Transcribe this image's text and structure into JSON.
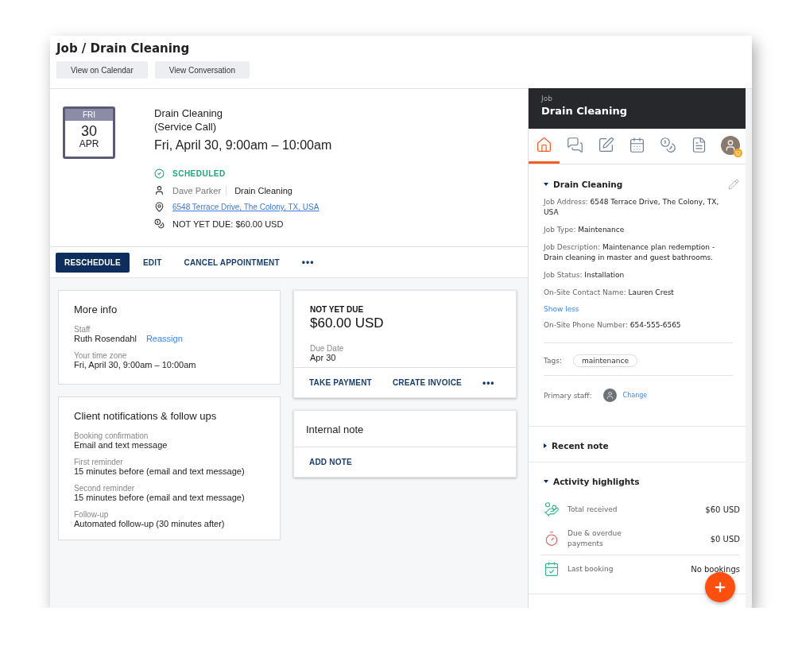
{
  "header": {
    "title": "Job / Drain Cleaning",
    "buttons": [
      "View on Calendar",
      "View Conversation"
    ]
  },
  "summary": {
    "calendar": {
      "weekday": "FRI",
      "day": "30",
      "month": "APR"
    },
    "title_lines": [
      "Drain Cleaning",
      "(Service Call)"
    ],
    "datetime": "Fri, April 30, 9:00am – 10:00am",
    "status": "SCHEDULED",
    "staff": "Dave Parker",
    "service": "Drain Cleaning",
    "address": "6548 Terrace Drive, The Colony, TX, USA",
    "payment": "NOT YET DUE: $60.00 USD"
  },
  "actions": [
    {
      "label": "RESCHEDULE",
      "kind": "primary"
    },
    {
      "label": "EDIT",
      "kind": "text"
    },
    {
      "label": "CANCEL APPOINTMENT",
      "kind": "text"
    },
    {
      "label": "•••",
      "kind": "more"
    }
  ],
  "more_info": {
    "title": "More info",
    "staff_label": "Staff",
    "staff": "Ruth Rosendahl",
    "reassign": "Reassign",
    "tz_label": "Your time zone",
    "tz_value": "Fri, April 30, 9:00am – 10:00am"
  },
  "notifications": {
    "title": "Client notifications & follow ups",
    "items": [
      {
        "label": "Booking confirmation",
        "value": "Email and text message"
      },
      {
        "label": "First reminder",
        "value": "15 minutes before (email and text message)"
      },
      {
        "label": "Second reminder",
        "value": "15 minutes before (email and text message)"
      },
      {
        "label": "Follow-up",
        "value": "Automated follow-up (30 minutes after)"
      }
    ]
  },
  "payment_card": {
    "status": "NOT YET DUE",
    "amount": "$60.00 USD",
    "due_label": "Due Date",
    "due_value": "Apr 30",
    "actions": [
      {
        "label": "TAKE PAYMENT",
        "kind": "text"
      },
      {
        "label": "CREATE INVOICE",
        "kind": "text"
      },
      {
        "label": "•••",
        "kind": "more"
      }
    ]
  },
  "note_card": {
    "title": "Internal note",
    "action": "ADD NOTE"
  },
  "side_panel": {
    "eyebrow": "Job",
    "title": "Drain Cleaning",
    "tabs": [
      {
        "kind": "info",
        "selected": true
      },
      {
        "kind": "chat",
        "selected": false
      },
      {
        "kind": "note",
        "selected": false
      },
      {
        "kind": "calendar",
        "selected": false
      },
      {
        "kind": "coins",
        "selected": false
      },
      {
        "kind": "document",
        "selected": false
      },
      {
        "kind": "avatar",
        "selected": false
      }
    ],
    "details": {
      "title": "Drain Cleaning",
      "expanded": true,
      "rows": [
        {
          "kind": "field",
          "label": "Job Address:",
          "value": "6548 Terrace Drive, The Colony, TX, USA"
        },
        {
          "kind": "field",
          "label": "Job Type:",
          "value": "Maintenance"
        },
        {
          "kind": "field",
          "label": "Job Description:",
          "value": "Maintenance plan redemption - Drain cleaning in master and guest bathrooms."
        },
        {
          "kind": "field",
          "label": "Job Status:",
          "value": "Installation"
        },
        {
          "kind": "field",
          "label": "On-Site Contact Name:",
          "value": "Lauren Crest"
        },
        {
          "kind": "link",
          "value": "Show less"
        },
        {
          "kind": "field",
          "label": "On-Site Phone Number:",
          "value": "654-555-6565"
        }
      ],
      "tags_label": "Tags:",
      "tags": [
        "maintenance"
      ],
      "staff_label": "Primary staff:",
      "staff_link": "Change"
    },
    "sections": [
      {
        "title": "Recent note",
        "expanded": false
      },
      {
        "title": "Activity highlights",
        "expanded": true,
        "items": [
          {
            "kind": "received",
            "label": "Total received",
            "value": "$60 USD"
          },
          {
            "kind": "due",
            "label": "Due & overdue payments",
            "value": "$0 USD"
          },
          {
            "kind": "booking",
            "label": "Last booking",
            "value": "No bookings"
          }
        ]
      }
    ]
  }
}
